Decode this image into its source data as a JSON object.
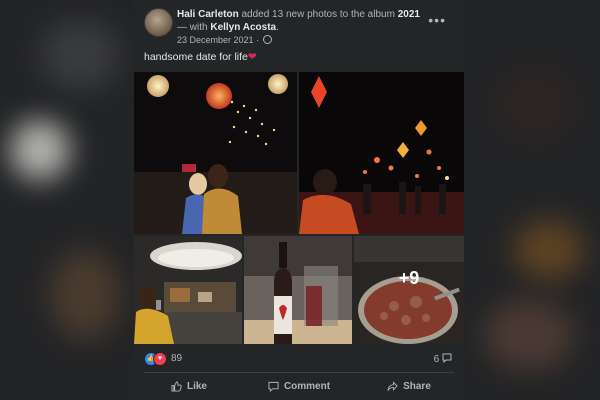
{
  "post": {
    "author": "Hali Carleton",
    "action_text": "added 13 new photos to the album",
    "album": "2021",
    "with_text": "— with",
    "tagged": "Kellyn Acosta",
    "period": ".",
    "date": "23 December 2021",
    "separator": "·",
    "more": "•••",
    "caption": "handsome date for life",
    "caption_emoji": "❤",
    "more_photos_overlay": "+9"
  },
  "reactions": {
    "count": "89",
    "comments": "6"
  },
  "actions": {
    "like": "Like",
    "comment": "Comment",
    "share": "Share"
  },
  "colors": {
    "post_bg": "#242526",
    "text": "#e4e6eb",
    "secondary": "#b0b3b8",
    "like_blue": "#2d88ff",
    "love_red": "#f33e58"
  },
  "icons": [
    "globe-icon",
    "more-options-icon",
    "like-reaction-icon",
    "love-reaction-icon",
    "comment-bubble-icon",
    "thumb-up-icon",
    "comment-icon",
    "share-icon"
  ]
}
